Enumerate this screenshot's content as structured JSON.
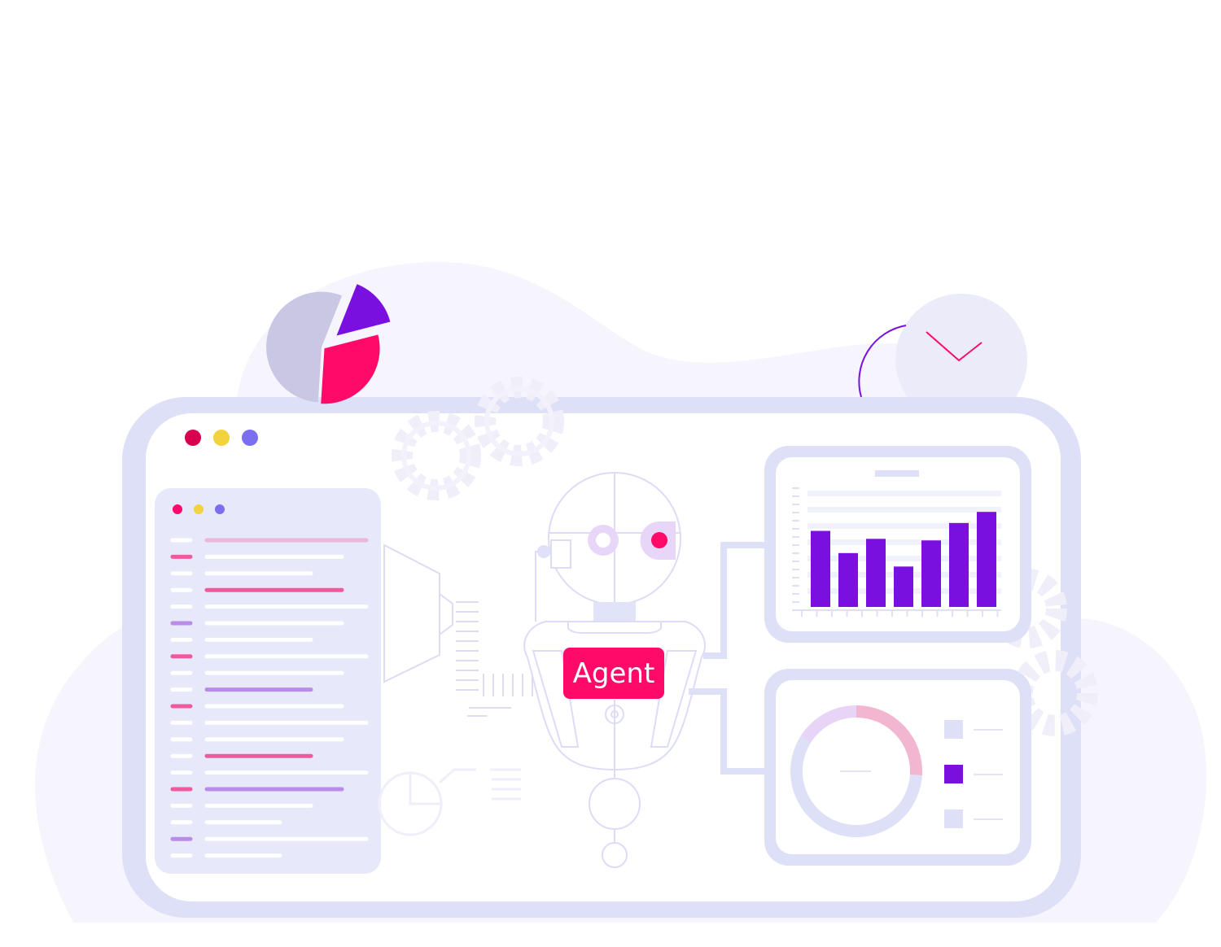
{
  "agent": {
    "label": "Agent",
    "label_color": "#ffffff",
    "badge_color": "#ff0a68"
  },
  "window": {
    "controls": [
      {
        "name": "close",
        "color": "#d8004f"
      },
      {
        "name": "minimize",
        "color": "#f2d23d"
      },
      {
        "name": "maximize",
        "color": "#7b6ff0"
      }
    ]
  },
  "sidebar": {
    "controls": [
      {
        "name": "close",
        "color": "#ff0a68"
      },
      {
        "name": "minimize",
        "color": "#f2d23d"
      },
      {
        "name": "maximize",
        "color": "#7b6ff0"
      }
    ]
  },
  "icons": [
    "pie-chart-icon",
    "clock-icon",
    "gear-icon",
    "robot-icon",
    "bar-chart-icon",
    "donut-chart-icon",
    "funnel-icon"
  ],
  "colors": {
    "frame": "#dde0f7",
    "accent_magenta": "#ff0a68",
    "accent_purple": "#7a10df",
    "pale_lilac": "#f6f4fd",
    "robot_line": "#dcdcf7",
    "pink_soft": "#f2b6d1"
  },
  "pie_decor": {
    "slices": [
      {
        "name": "grey",
        "value": 0.55,
        "color": "#c9c7e3"
      },
      {
        "name": "magenta",
        "value": 0.3,
        "color": "#ff0a68"
      },
      {
        "name": "purple",
        "value": 0.15,
        "color": "#7a10df"
      }
    ]
  },
  "chart_data": [
    {
      "type": "bar",
      "values": [
        96,
        68,
        86,
        51,
        84,
        106,
        120
      ],
      "ylim": [
        0,
        150
      ],
      "color": "#7a10df",
      "grid": true
    },
    {
      "type": "pie",
      "values": [
        58,
        26,
        16
      ],
      "colors": [
        "#dde0f7",
        "#f2b6d1",
        "#e8d4f7"
      ],
      "legend_colors": [
        "#dde0f7",
        "#7a10df",
        "#dde0f7"
      ],
      "legend": "right"
    }
  ]
}
